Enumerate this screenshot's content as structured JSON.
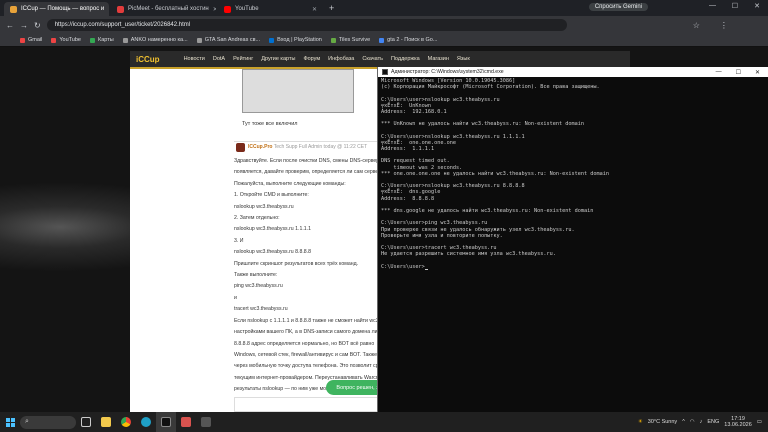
{
  "browser": {
    "tabs": [
      {
        "label": "ICCup — Помощь — вопрос и",
        "color": "#e8a33a",
        "active": true
      },
      {
        "label": "PicMeet - бесплатный хостин",
        "color": "#e33c3c",
        "active": false
      },
      {
        "label": "YouTube",
        "color": "#ff0000",
        "active": false
      }
    ],
    "newtab": "+",
    "gemini": "Спросить Gemini",
    "url": "https://iccup.com/support_user/ticket/2026842.html",
    "bookmarks": [
      "Gmail",
      "YouTube",
      "Карты",
      "ANKO намеренно ка...",
      "GTA San Andreas св...",
      "Вход | PlayStation",
      "Tiles Survive",
      "gta 2 - Поиск в Go..."
    ]
  },
  "site": {
    "logo": "iCCup",
    "nav": [
      "Новости",
      "DotA",
      "Рейтинг",
      "Другие карты",
      "Форум",
      "Инфобаза",
      "Скачать",
      "Поддержка",
      "Магазин",
      "Язык"
    ]
  },
  "ticket": {
    "caption": "Тут тоже все включил",
    "author": "ICCup.Pro",
    "author_meta": "Tech Supp Full Admin today @ 11:22 CET",
    "lines": [
      "Здравствуйте. Если после очистки DNS, смены DNS-сервера",
      "появляется, давайте проверим, определяется ли сам сервер",
      "Пожалуйста, выполните следующие команды:",
      "1. Откройте CMD и выполните:",
      "nslookup wc3.theabyss.ru",
      "2. Затем отдельно:",
      "nslookup wc3.theabyss.ru 1.1.1.1",
      "3. И",
      "nslookup wc3.theabyss.ru 8.8.8.8",
      "Пришлите скриншот результатов всех трёх команд.",
      "Также выполните:",
      "ping wc3.theabyss.ru",
      "и",
      "tracert wc3.theabyss.ru",
      "Если nslookup с 1.1.1.1 и 8.8.8.8 также не сможет найти wc3",
      "настройками вашего ПК, а в DNS-записи самого домена либо",
      "8.8.8.8 адрес определяется нормально, но ВОТ всё равно",
      "Windows, сетевой стек, firewall/антивирус и сам ВОТ. Также",
      "через мобильную точку доступа телефона. Это позволит сра",
      "текущим интернет-провайдером. Переустанавливать Warcraf",
      "результаты nslookup — по ним уже можно будет точно опре"
    ],
    "resolve_button": "Вопрос решен, закрыть тикет",
    "scroll_top": "↑"
  },
  "cmd": {
    "title": "Администратор: C:\\Windows\\system32\\cmd.exe",
    "lines": [
      "Microsoft Windows [Version 10.0.19045.3086]",
      "(c) Корпорация Майкрософт (Microsoft Corporation). Все права защищены.",
      "",
      "C:\\Users\\user>nslookup wc3.theabyss.ru",
      "╤хЁтхЁ:  UnKnown",
      "Address:  192.168.0.1",
      "",
      "*** UnKnown не удалось найти wc3.theabyss.ru: Non-existent domain",
      "",
      "C:\\Users\\user>nslookup wc3.theabyss.ru 1.1.1.1",
      "╤хЁтхЁ:  one.one.one.one",
      "Address:  1.1.1.1",
      "",
      "DNS request timed out.",
      "    timeout was 2 seconds.",
      "*** one.one.one.one не удалось найти wc3.theabyss.ru: Non-existent domain",
      "",
      "C:\\Users\\user>nslookup wc3.theabyss.ru 8.8.8.8",
      "╤хЁтхЁ:  dns.google",
      "Address:  8.8.8.8",
      "",
      "*** dns.google не удалось найти wc3.theabyss.ru: Non-existent domain",
      "",
      "C:\\Users\\user>ping wc3.theabyss.ru",
      "При проверке связи не удалось обнаружить узел wc3.theabyss.ru.",
      "Проверьте имя узла и повторите попытку.",
      "",
      "C:\\Users\\user>tracert wc3.theabyss.ru",
      "Не удается разрешить системное имя узла wc3.theabyss.ru.",
      "",
      "C:\\Users\\user>"
    ]
  },
  "taskbar": {
    "search_icon": "search-icon",
    "weather": "30°C  Sunny",
    "lang": "ENG",
    "time": "17:19",
    "date": "13.06.2026"
  }
}
